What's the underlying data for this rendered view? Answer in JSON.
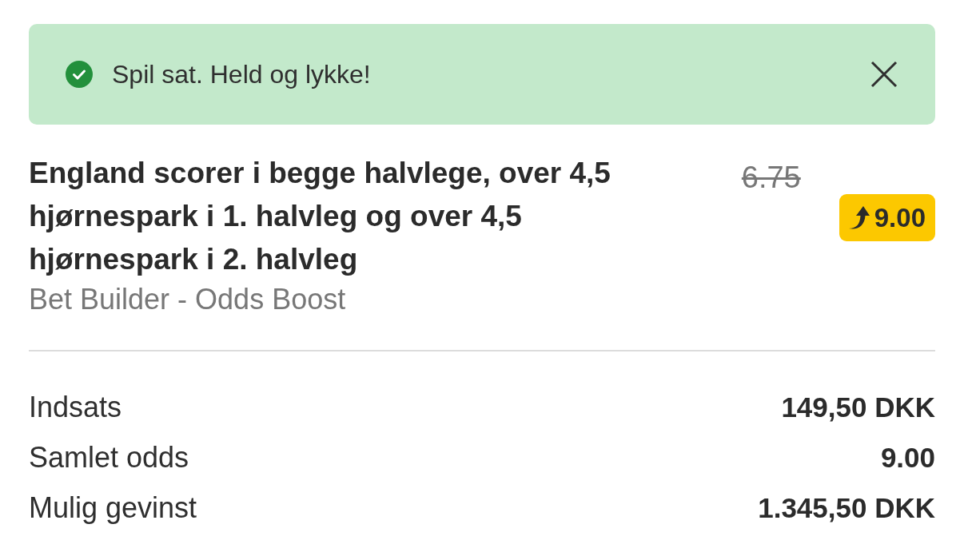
{
  "notification": {
    "kind": "success",
    "message": "Spil sat. Held og lykke!"
  },
  "selection": {
    "title": "England scorer i begge halvlege, over 4,5 hjørnespark i 1. halvleg og over 4,5 hjørnespark i 2. halvleg",
    "market": "Bet Builder - Odds Boost",
    "odds_before": "6.75",
    "odds_boosted": "9.00"
  },
  "summary": [
    {
      "label": "Indsats",
      "value": "149,50 DKK"
    },
    {
      "label": "Samlet odds",
      "value": "9.00"
    },
    {
      "label": "Mulig gevinst",
      "value": "1.345,50 DKK"
    }
  ]
}
